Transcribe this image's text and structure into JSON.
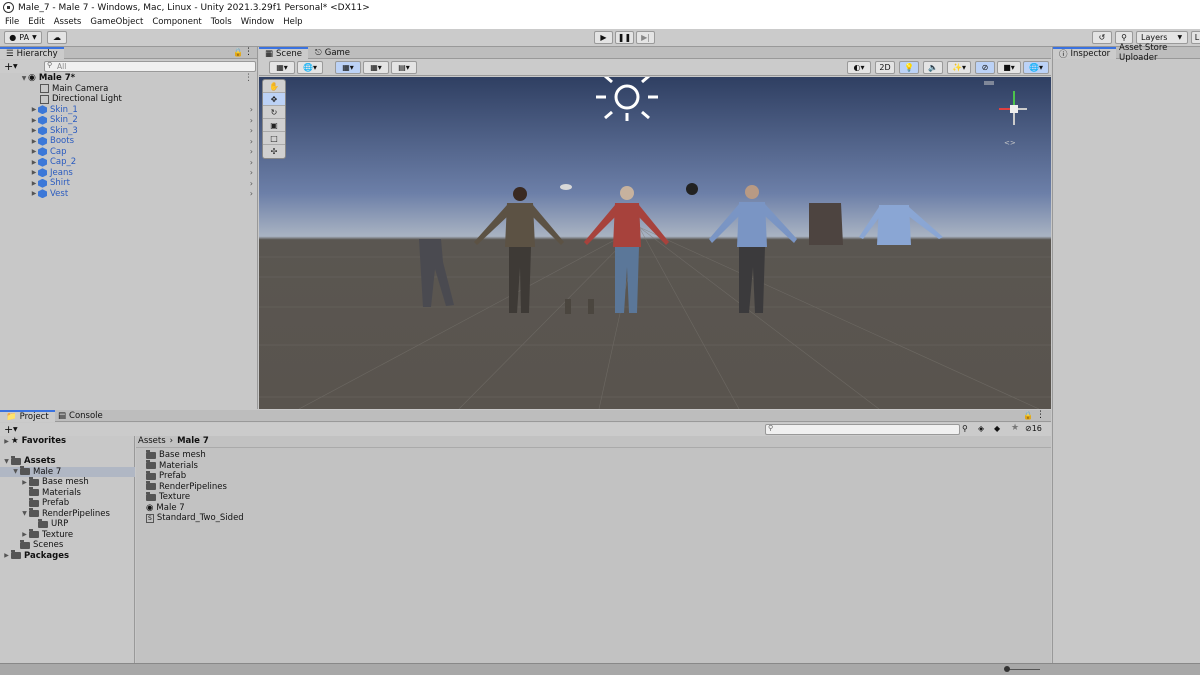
{
  "window": {
    "title": "Male_7 - Male 7 - Windows, Mac, Linux - Unity 2021.3.29f1 Personal* <DX11>"
  },
  "menu": [
    "File",
    "Edit",
    "Assets",
    "GameObject",
    "Component",
    "Tools",
    "Window",
    "Help"
  ],
  "toolbar": {
    "account": "PA",
    "layers_label": "Layers",
    "layout_label": "L"
  },
  "hierarchy": {
    "tab": "Hierarchy",
    "search_placeholder": "All",
    "root": "Male 7*",
    "items": [
      {
        "label": "Main Camera",
        "prefab": false
      },
      {
        "label": "Directional Light",
        "prefab": false
      },
      {
        "label": "Skin_1",
        "prefab": true
      },
      {
        "label": "Skin_2",
        "prefab": true
      },
      {
        "label": "Skin_3",
        "prefab": true
      },
      {
        "label": "Boots",
        "prefab": true
      },
      {
        "label": "Cap",
        "prefab": true
      },
      {
        "label": "Cap_2",
        "prefab": true
      },
      {
        "label": "Jeans",
        "prefab": true
      },
      {
        "label": "Shirt",
        "prefab": true
      },
      {
        "label": "Vest",
        "prefab": true
      }
    ]
  },
  "scene": {
    "tabs": [
      "Scene",
      "Game"
    ],
    "mode_2d": "2D"
  },
  "inspector": {
    "tabs": [
      "Inspector",
      "Asset Store Uploader"
    ]
  },
  "project": {
    "tabs": [
      "Project",
      "Console"
    ],
    "favorites": "Favorites",
    "assets": "Assets",
    "tree": [
      {
        "label": "Male 7",
        "depth": 1
      },
      {
        "label": "Base mesh",
        "depth": 2
      },
      {
        "label": "Materials",
        "depth": 2
      },
      {
        "label": "Prefab",
        "depth": 2
      },
      {
        "label": "RenderPipelines",
        "depth": 2
      },
      {
        "label": "URP",
        "depth": 3
      },
      {
        "label": "Texture",
        "depth": 2
      },
      {
        "label": "Scenes",
        "depth": 1
      }
    ],
    "packages": "Packages",
    "breadcrumb": [
      "Assets",
      "Male 7"
    ],
    "files": [
      {
        "label": "Base mesh",
        "kind": "folder"
      },
      {
        "label": "Materials",
        "kind": "folder"
      },
      {
        "label": "Prefab",
        "kind": "folder"
      },
      {
        "label": "RenderPipelines",
        "kind": "folder"
      },
      {
        "label": "Texture",
        "kind": "folder"
      },
      {
        "label": "Male 7",
        "kind": "scene"
      },
      {
        "label": "Standard_Two_Sided",
        "kind": "shader"
      }
    ],
    "hidden_count": "16"
  }
}
